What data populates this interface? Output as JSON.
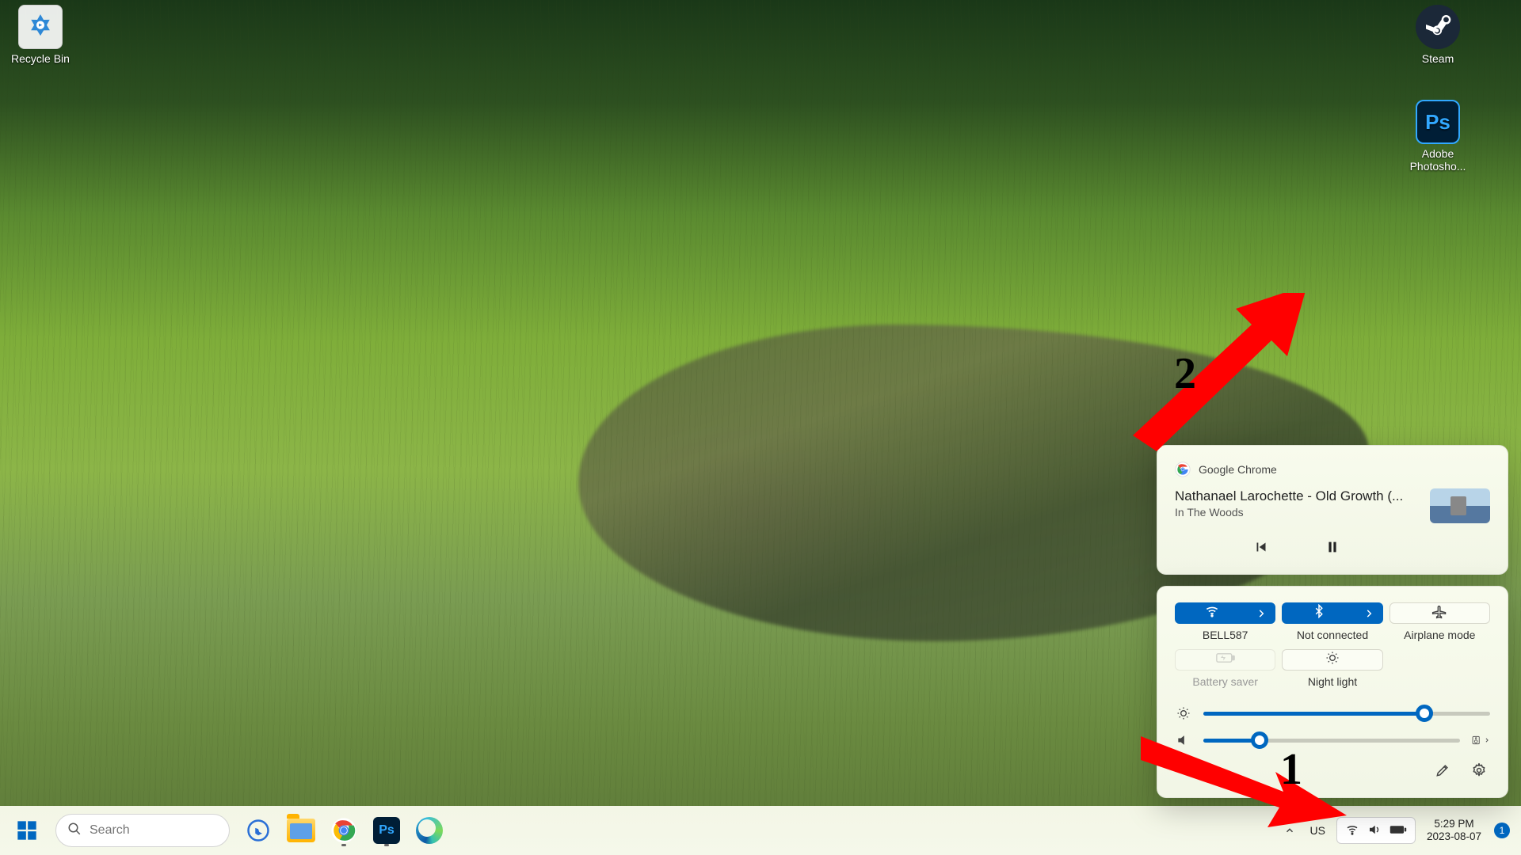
{
  "desktop_icons": {
    "recycle_bin": "Recycle Bin",
    "steam": "Steam",
    "photoshop": "Adobe Photosho..."
  },
  "annotations": {
    "arrow1_label": "1",
    "arrow2_label": "2"
  },
  "media_panel": {
    "source_app": "Google Chrome",
    "title": "Nathanael Larochette - Old Growth (...",
    "subtitle": "In The Woods"
  },
  "quick_settings": {
    "wifi": {
      "label": "BELL587",
      "active": true
    },
    "bluetooth": {
      "label": "Not connected",
      "active": true
    },
    "airplane": {
      "label": "Airplane mode",
      "active": false
    },
    "battery_saver": {
      "label": "Battery saver",
      "disabled": true
    },
    "night_light": {
      "label": "Night light",
      "active": false
    },
    "brightness_pct": 77,
    "volume_pct": 22
  },
  "taskbar": {
    "search_placeholder": "Search",
    "language": "US",
    "time": "5:29 PM",
    "date": "2023-08-07",
    "notification_count": "1"
  },
  "colors": {
    "accent": "#0067c0"
  }
}
